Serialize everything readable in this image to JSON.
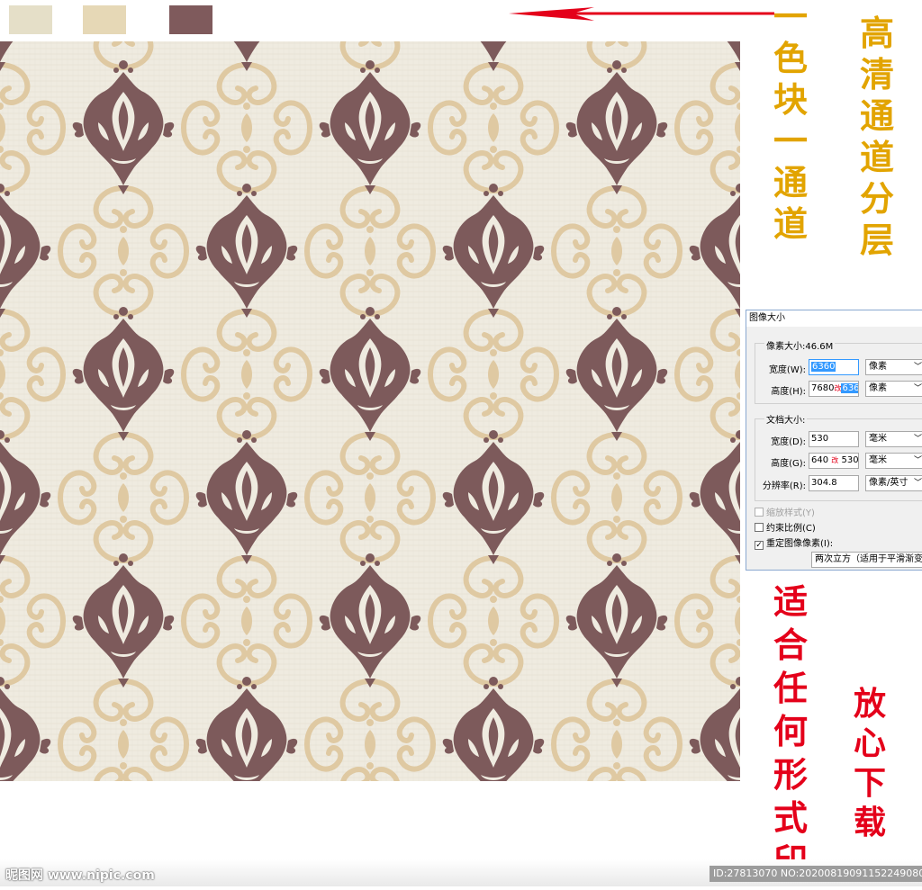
{
  "colors": {
    "swatch_1": "#e5dfc8",
    "swatch_2": "#e6d8b6",
    "swatch_3": "#7f5a5c",
    "background": "#efebe0",
    "ornament_gold": "#dfc9a2",
    "damask_brown": "#7d5a5b",
    "arrow_red": "#e4001a",
    "headline_gold": "#e2a400",
    "headline_red": "#e4001a"
  },
  "annotations": {
    "left_vertical": [
      "一",
      "色",
      "块",
      "一",
      "通",
      "道"
    ],
    "right_vertical": [
      "高",
      "清",
      "通",
      "道",
      "分",
      "层"
    ],
    "red_left_vertical": [
      "适",
      "合",
      "任",
      "何",
      "形",
      "式",
      "印"
    ],
    "red_right_vertical": [
      "放",
      "心",
      "下",
      "载"
    ]
  },
  "dialog": {
    "title": "图像大小",
    "pixel_size_label": "像素大小:46.6M",
    "width_label": "宽度(W):",
    "width_value": "6360",
    "width_unit": "像素",
    "height_label": "高度(H):",
    "height_old": "7680",
    "height_mark": "改",
    "height_value": "6360",
    "height_unit": "像素",
    "doc_size_label": "文档大小:",
    "doc_width_label": "宽度(D):",
    "doc_width_value": "530",
    "doc_width_unit": "毫米",
    "doc_height_label": "高度(G):",
    "doc_height_old": "640",
    "doc_height_mark": "改",
    "doc_height_value": "530",
    "doc_height_unit": "毫米",
    "resolution_label": "分辨率(R):",
    "resolution_value": "304.8",
    "resolution_unit": "像素/英寸",
    "scale_styles": "缩放样式(Y)",
    "constrain": "约束比例(C)",
    "resample": "重定图像像素(I):",
    "resample_method": "两次立方（适用于平滑渐变"
  },
  "footer": {
    "site": "昵图网 www.nipic.com",
    "id_text": "ID:27813070 NO:20200819091152249080"
  }
}
